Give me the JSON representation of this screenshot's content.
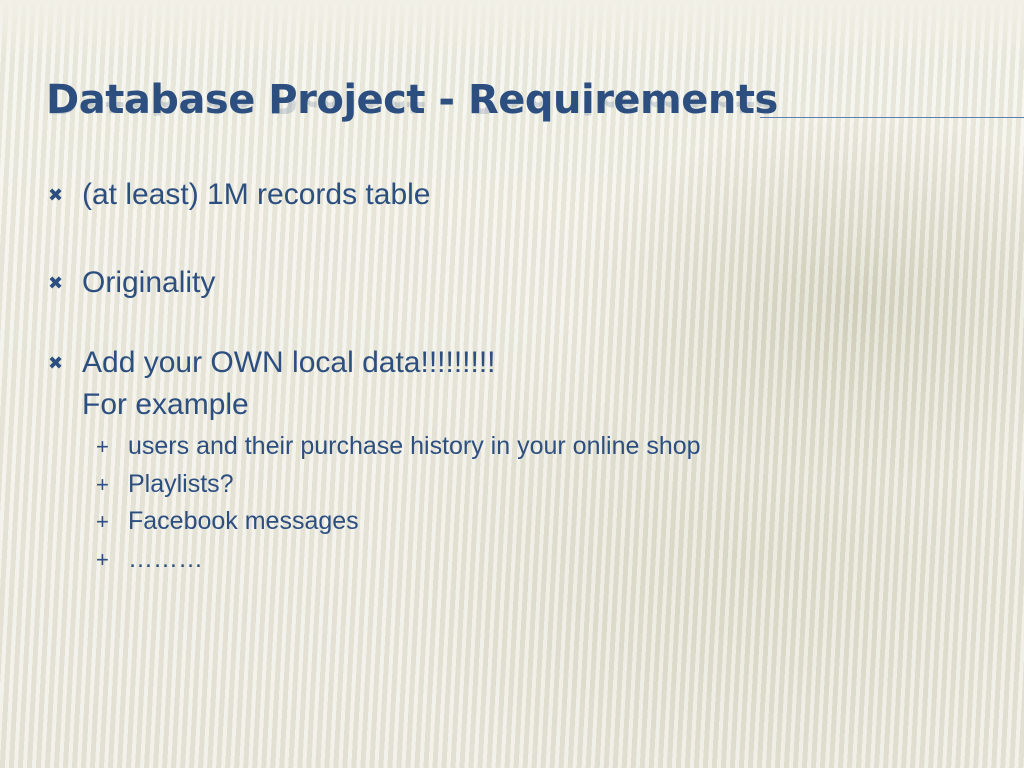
{
  "slide": {
    "title": "Database Project - Requirements",
    "bullets": [
      {
        "marker": "✖",
        "text": "(at least) 1M records table"
      },
      {
        "marker": "✖",
        "text": "Originality"
      },
      {
        "marker": "✖",
        "text": "Add your OWN local data!!!!!!!!!",
        "continuation": "For example"
      }
    ],
    "sub_bullets": [
      {
        "marker": "+",
        "text": "users and their purchase history in your online shop"
      },
      {
        "marker": "+",
        "text": "Playlists?"
      },
      {
        "marker": "+",
        "text": "Facebook messages"
      },
      {
        "marker": "+",
        "text": "………"
      }
    ]
  },
  "colors": {
    "title": "#2d4f80",
    "text": "#2d4f80",
    "rule": "#5b7fb0",
    "background": "#ecebdf"
  }
}
